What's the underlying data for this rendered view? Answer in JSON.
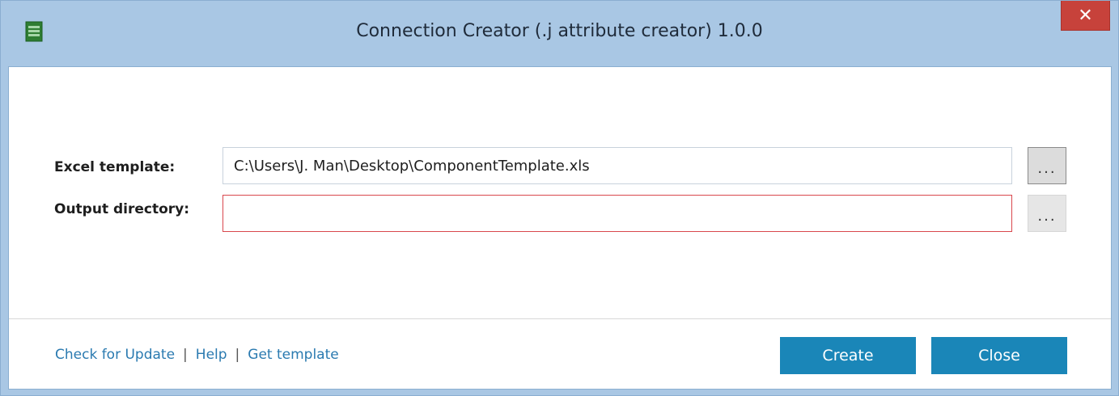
{
  "window": {
    "title": "Connection Creator (.j attribute creator) 1.0.0",
    "close_glyph": "✕"
  },
  "form": {
    "excel_template_label": "Excel template:",
    "excel_template_value": "C:\\Users\\J. Man\\Desktop\\ComponentTemplate.xls",
    "output_directory_label": "Output directory:",
    "output_directory_value": "",
    "browse_label": "..."
  },
  "footer": {
    "links": [
      "Check for Update",
      "Help",
      "Get template"
    ],
    "separator": "|",
    "create_label": "Create",
    "close_label": "Close"
  },
  "colors": {
    "titlebar": "#a9c7e4",
    "close_button": "#c7423b",
    "accent_button": "#1a86b8",
    "link": "#2a7ab0",
    "error_border": "#d9474d"
  },
  "icons": {
    "app": "app-window-icon",
    "close": "close-icon"
  }
}
